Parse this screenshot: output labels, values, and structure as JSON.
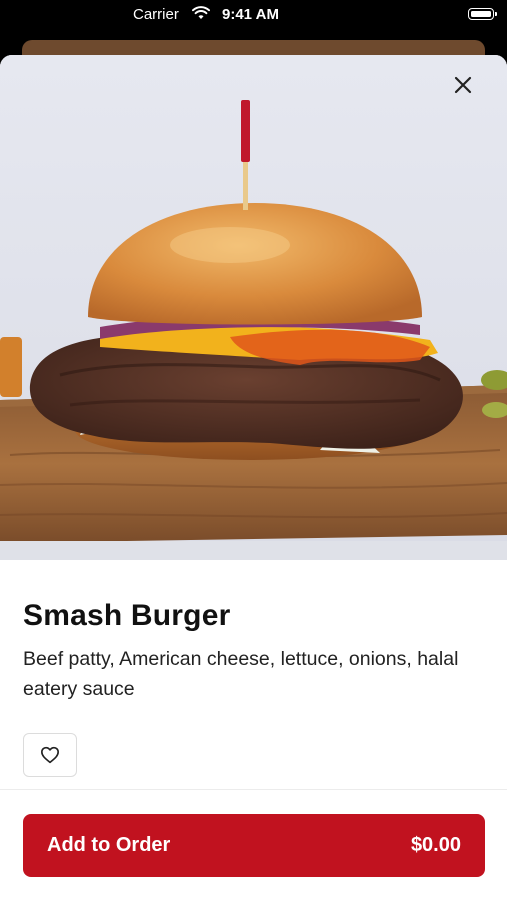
{
  "status_bar": {
    "carrier": "Carrier",
    "time": "9:41 AM"
  },
  "item": {
    "name": "Smash Burger",
    "description": "Beef patty, American cheese, lettuce, onions, halal eatery sauce"
  },
  "actions": {
    "add_to_order_label": "Add to Order",
    "price": "$0.00"
  },
  "colors": {
    "accent": "#c1121f",
    "background": "#ffffff"
  },
  "icons": {
    "close": "close-icon",
    "favorite": "heart-icon",
    "wifi": "wifi-icon",
    "battery": "battery-icon"
  }
}
